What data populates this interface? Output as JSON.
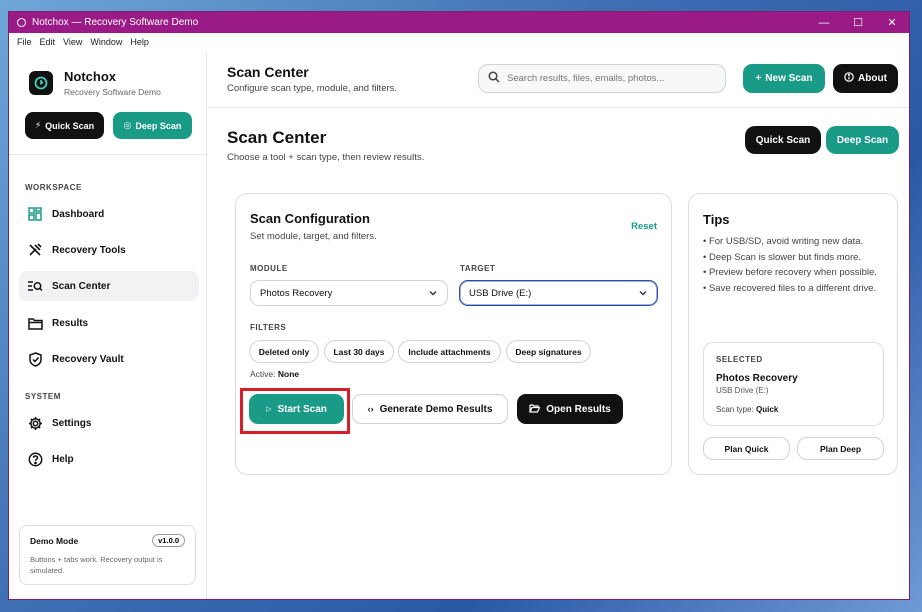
{
  "window": {
    "title": "Notchox — Recovery Software Demo",
    "controls": [
      "—",
      "☐",
      "✕"
    ]
  },
  "menu": [
    "File",
    "Edit",
    "View",
    "Window",
    "Help"
  ],
  "sidebar": {
    "brand_name": "Notchox",
    "brand_sub": "Recovery Software Demo",
    "quick_scan": "Quick Scan",
    "deep_scan": "Deep Scan",
    "workspace_label": "WORKSPACE",
    "system_label": "SYSTEM",
    "items": [
      {
        "label": "Dashboard",
        "icon": "dashboard-icon"
      },
      {
        "label": "Recovery Tools",
        "icon": "tools-icon"
      },
      {
        "label": "Scan Center",
        "icon": "scan-icon"
      },
      {
        "label": "Results",
        "icon": "folder-icon"
      },
      {
        "label": "Recovery Vault",
        "icon": "shield-icon"
      }
    ],
    "system_items": [
      {
        "label": "Settings",
        "icon": "gear-icon"
      },
      {
        "label": "Help",
        "icon": "help-icon"
      }
    ],
    "demo": {
      "title": "Demo Mode",
      "version": "v1.0.0",
      "text": "Buttons + tabs work. Recovery output is simulated."
    }
  },
  "topbar": {
    "title": "Scan Center",
    "subtitle": "Configure scan type, module, and filters.",
    "search_placeholder": "Search results, files, emails, photos...",
    "new_scan": "New Scan",
    "about": "About"
  },
  "page": {
    "title": "Scan Center",
    "subtitle": "Choose a tool + scan type, then review results.",
    "quick_scan": "Quick Scan",
    "deep_scan": "Deep Scan"
  },
  "config": {
    "title": "Scan Configuration",
    "subtitle": "Set module, target, and filters.",
    "reset": "Reset",
    "module_label": "MODULE",
    "module_value": "Photos Recovery",
    "target_label": "TARGET",
    "target_value": "USB Drive (E:)",
    "filters_label": "FILTERS",
    "filters": [
      "Deleted only",
      "Last 30 days",
      "Include attachments",
      "Deep signatures"
    ],
    "active_label": "Active:",
    "active_value": "None",
    "start_scan": "Start Scan",
    "generate": "Generate Demo Results",
    "open_results": "Open Results"
  },
  "tips": {
    "title": "Tips",
    "items": [
      "• For USB/SD, avoid writing new data.",
      "• Deep Scan is slower but finds more.",
      "• Preview before recovery when possible.",
      "• Save recovered files to a different drive."
    ],
    "selected_label": "SELECTED",
    "selected_name": "Photos Recovery",
    "selected_target": "USB Drive (E:)",
    "scan_type_label": "Scan type:",
    "scan_type_value": "Quick",
    "plan_quick": "Plan Quick",
    "plan_deep": "Plan Deep"
  },
  "colors": {
    "titlebar": "#9b1b86",
    "accent": "#1a9b88",
    "dark": "#111111",
    "highlight": "#d61f27"
  }
}
